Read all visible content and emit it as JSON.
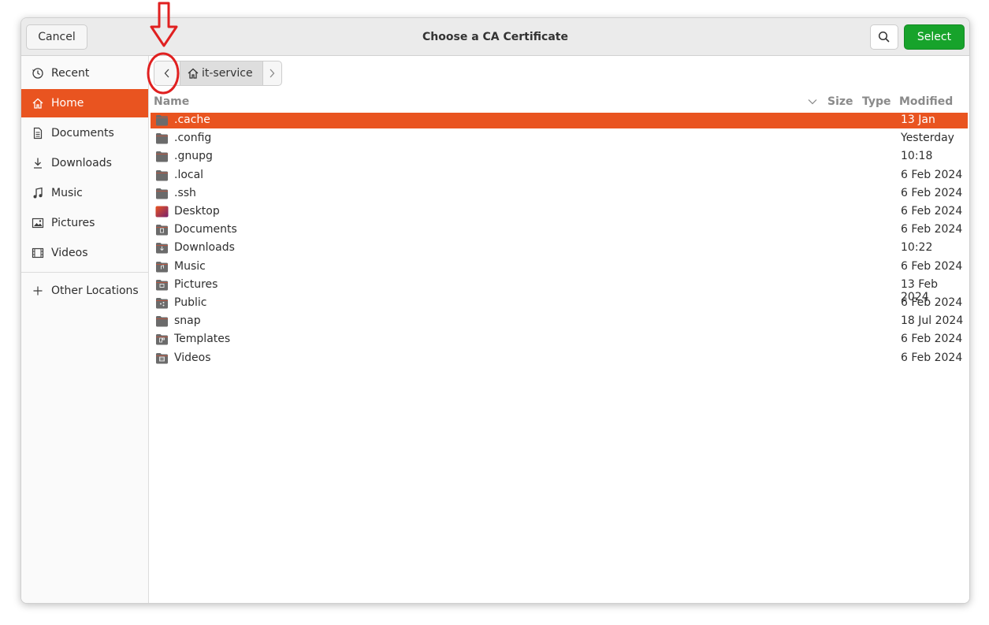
{
  "dialog": {
    "title": "Choose a CA Certificate",
    "cancel_label": "Cancel",
    "select_label": "Select",
    "search_icon": "search-icon",
    "accent_color": "#e95420",
    "select_color": "#17a32b"
  },
  "sidebar": {
    "items": [
      {
        "label": "Recent",
        "icon": "clock-icon"
      },
      {
        "label": "Home",
        "icon": "home-icon",
        "active": true
      },
      {
        "label": "Documents",
        "icon": "document-icon"
      },
      {
        "label": "Downloads",
        "icon": "download-icon"
      },
      {
        "label": "Music",
        "icon": "music-icon"
      },
      {
        "label": "Pictures",
        "icon": "picture-icon"
      },
      {
        "label": "Videos",
        "icon": "video-icon"
      }
    ],
    "other_locations": {
      "label": "Other Locations",
      "icon": "plus-icon"
    }
  },
  "pathbar": {
    "current": "it-service",
    "back_icon": "chevron-left-icon",
    "forward_icon": "chevron-right-icon"
  },
  "columns": {
    "name": "Name",
    "size": "Size",
    "type": "Type",
    "modified": "Modified"
  },
  "files": [
    {
      "name": ".cache",
      "modified": "13 Jan",
      "icon": "folder-icon",
      "selected": true
    },
    {
      "name": ".config",
      "modified": "Yesterday",
      "icon": "folder-icon"
    },
    {
      "name": ".gnupg",
      "modified": "10:18",
      "icon": "folder-icon"
    },
    {
      "name": ".local",
      "modified": "6 Feb 2024",
      "icon": "folder-icon"
    },
    {
      "name": ".ssh",
      "modified": "6 Feb 2024",
      "icon": "folder-icon"
    },
    {
      "name": "Desktop",
      "modified": "6 Feb 2024",
      "icon": "desktop-folder-icon"
    },
    {
      "name": "Documents",
      "modified": "6 Feb 2024",
      "icon": "documents-folder-icon"
    },
    {
      "name": "Downloads",
      "modified": "10:22",
      "icon": "downloads-folder-icon"
    },
    {
      "name": "Music",
      "modified": "6 Feb 2024",
      "icon": "music-folder-icon"
    },
    {
      "name": "Pictures",
      "modified": "13 Feb 2024",
      "icon": "pictures-folder-icon"
    },
    {
      "name": "Public",
      "modified": "6 Feb 2024",
      "icon": "public-folder-icon"
    },
    {
      "name": "snap",
      "modified": "18 Jul 2024",
      "icon": "folder-icon"
    },
    {
      "name": "Templates",
      "modified": "6 Feb 2024",
      "icon": "templates-folder-icon"
    },
    {
      "name": "Videos",
      "modified": "6 Feb 2024",
      "icon": "videos-folder-icon"
    }
  ],
  "annotation": {
    "color": "#e02020",
    "arrow_icon": "down-arrow-annotation",
    "circle_icon": "circle-annotation"
  }
}
